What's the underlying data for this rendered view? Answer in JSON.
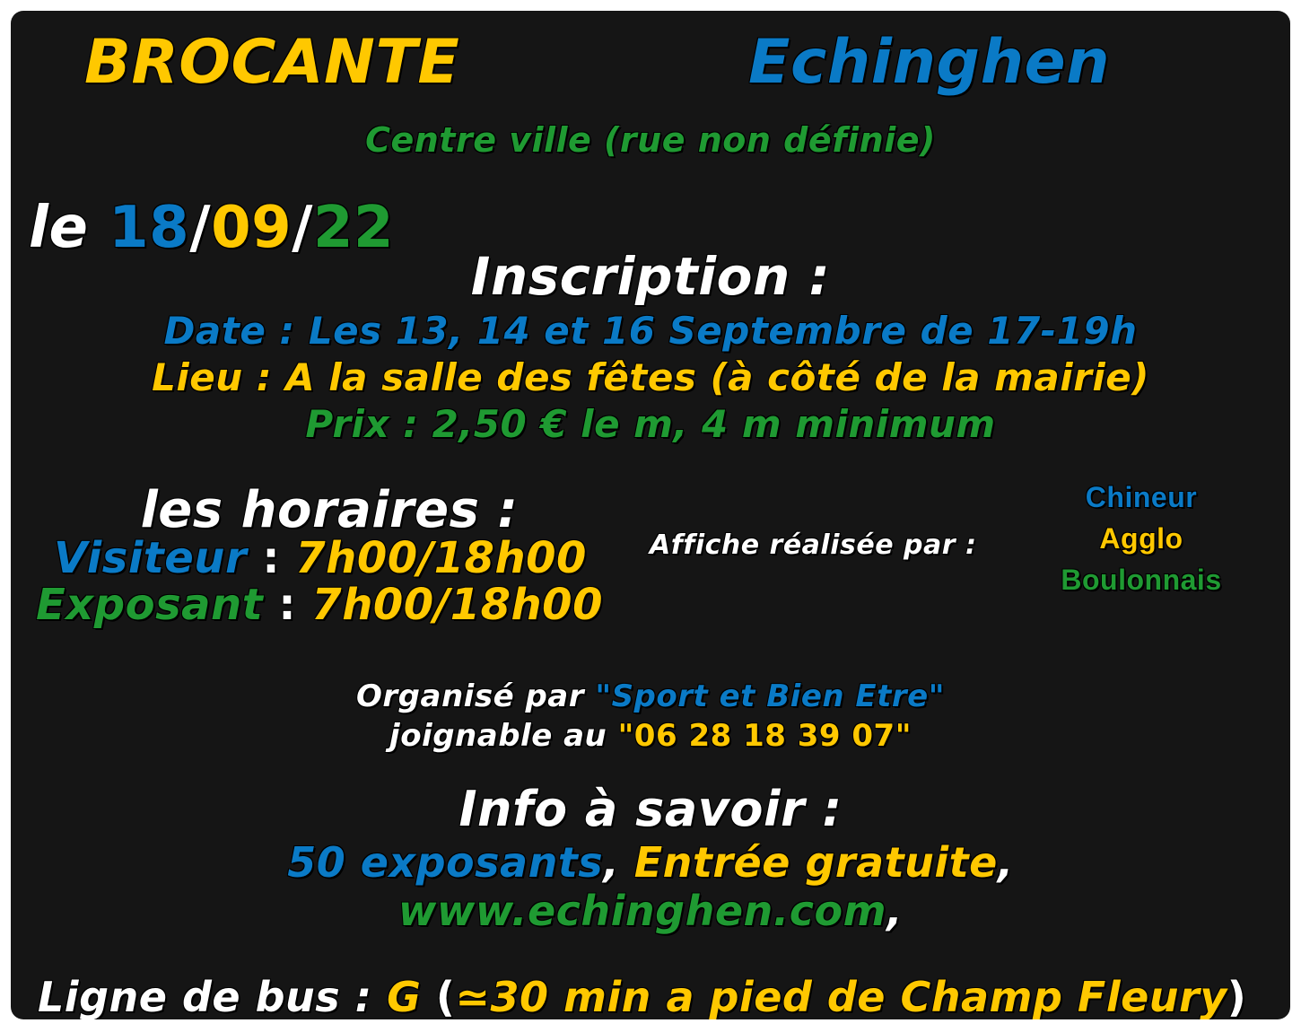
{
  "header": {
    "title": "BROCANTE",
    "town": "Echinghen",
    "location": "Centre ville (rue non définie)"
  },
  "date": {
    "prefix": "le",
    "day": "18",
    "month": "09",
    "year": "22",
    "sep": "/"
  },
  "inscription": {
    "heading": "Inscription :",
    "date_line": "Date :  Les 13, 14 et 16 Septembre de 17-19h",
    "lieu_line": "Lieu : A la salle des fêtes (à côté de la mairie)",
    "prix_line": "Prix : 2,50 € le m, 4 m minimum"
  },
  "horaires": {
    "heading": "les horaires :",
    "visiteur_label": "Visiteur",
    "visiteur_time": "7h00/18h00",
    "exposant_label": "Exposant",
    "exposant_time": "7h00/18h00",
    "colon": " : "
  },
  "credit": {
    "label": "Affiche réalisée par :",
    "line1": "Chineur",
    "line2": "Agglo",
    "line3": "Boulonnais"
  },
  "organizer": {
    "prefix": "Organisé par ",
    "name": "\"Sport et Bien Etre\"",
    "contact_prefix": "joignable au ",
    "phone": "\"06 28 18 39 07\""
  },
  "info": {
    "heading": "Info à savoir :",
    "exposants": "50 exposants",
    "comma": ",",
    "entree": "Entrée gratuite",
    "website": "www.echinghen.com"
  },
  "bus": {
    "prefix": "Ligne de bus : ",
    "line": "G",
    "paren_open": " (",
    "detail": "≃30 min a pied de Champ Fleury",
    "paren_close": ")"
  },
  "colors": {
    "background": "#151515",
    "blue": "#0a7ac6",
    "yellow": "#ffc800",
    "green": "#1f9a32",
    "white": "#ffffff"
  }
}
